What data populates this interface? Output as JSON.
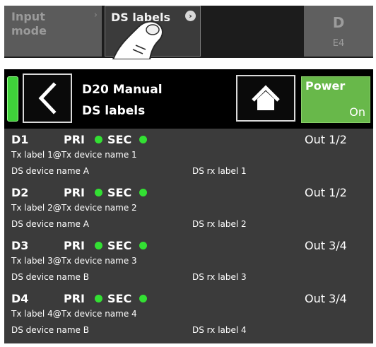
{
  "top_strip": {
    "input_mode_label": "Input\nmode",
    "ds_labels_label": "DS labels",
    "chevron": "›",
    "d_tile_label": "D",
    "d_tile_sub": "E4"
  },
  "header": {
    "line1": "D20 Manual",
    "line2": "DS labels",
    "power_label": "Power",
    "power_state": "On",
    "accent_green": "#68b84a",
    "led_color": "#3fd23a"
  },
  "rows": [
    {
      "id": "D1",
      "pri": "PRI",
      "sec": "SEC",
      "out": "Out 1/2",
      "tx": "Tx label 1@Tx device name 1",
      "device": "DS device name A",
      "rx": "DS rx label 1"
    },
    {
      "id": "D2",
      "pri": "PRI",
      "sec": "SEC",
      "out": "Out 1/2",
      "tx": "Tx label 2@Tx device name 2",
      "device": "DS device name A",
      "rx": "DS rx label 2"
    },
    {
      "id": "D3",
      "pri": "PRI",
      "sec": "SEC",
      "out": "Out 3/4",
      "tx": "Tx label 3@Tx device name 3",
      "device": "DS device name B",
      "rx": "DS rx label 3"
    },
    {
      "id": "D4",
      "pri": "PRI",
      "sec": "SEC",
      "out": "Out 3/4",
      "tx": "Tx label 4@Tx device name 4",
      "device": "DS device name B",
      "rx": "DS rx label 4"
    }
  ]
}
